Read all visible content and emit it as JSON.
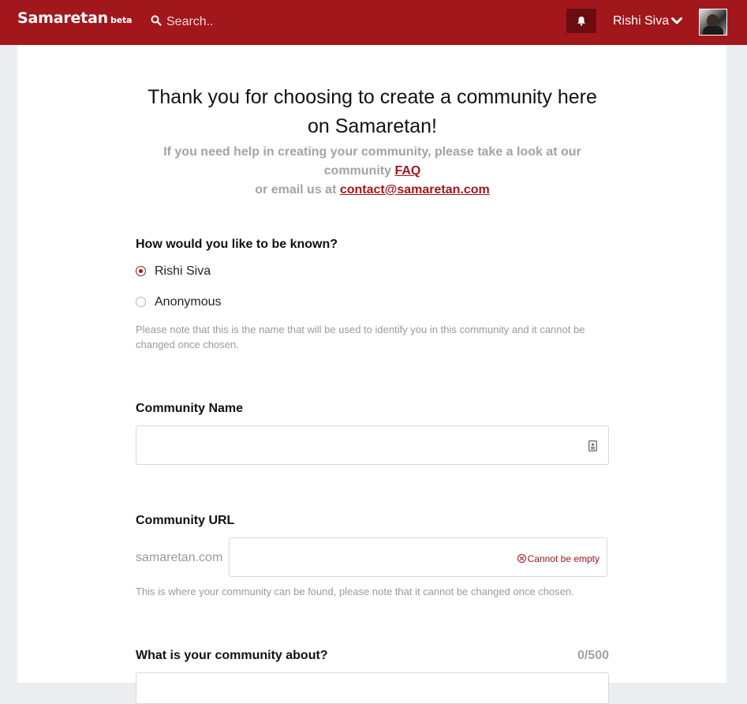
{
  "header": {
    "brand": "Samaretan",
    "brand_tag": "beta",
    "search_placeholder": "Search..",
    "user_name": "Rishi Siva",
    "icons": {
      "search": "search-icon",
      "bell": "bell-icon",
      "chevron": "chevron-down-icon",
      "avatar": "avatar-photo"
    },
    "colors": {
      "bar": "#a1171c",
      "bell_button": "#6b0d10"
    }
  },
  "main": {
    "title": "Thank you for choosing to create a community here on Samaretan!",
    "intro_text": "If you need help in creating your community, please take a look at our community",
    "faq_link": "FAQ",
    "intro_text_2": "or email us at",
    "email_link": "contact@samaretan.com",
    "identity": {
      "label": "How would you like to be known?",
      "options": [
        {
          "label": "Rishi Siva",
          "selected": true
        },
        {
          "label": "Anonymous",
          "selected": false
        }
      ],
      "note": "Please note that this is the name that will be used to identify you in this community and it cannot be changed once chosen."
    },
    "community_name": {
      "label": "Community Name",
      "value": "",
      "placeholder": ""
    },
    "community_url": {
      "label": "Community URL",
      "prefix": "samaretan.com",
      "value": "",
      "error": "Cannot be empty",
      "note": "This is where your community can be found, please note that it cannot be changed once chosen."
    },
    "about": {
      "label": "What is your community about?",
      "counter": "0/500"
    }
  }
}
